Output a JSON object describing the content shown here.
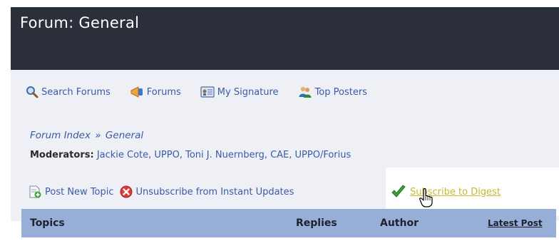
{
  "header": {
    "title": "Forum: General"
  },
  "toolbar": {
    "items": [
      {
        "label": "Search Forums",
        "icon": "magnifier-icon"
      },
      {
        "label": "Forums",
        "icon": "megaphone-icon"
      },
      {
        "label": "My Signature",
        "icon": "signature-card-icon"
      },
      {
        "label": "Top Posters",
        "icon": "users-icon"
      }
    ]
  },
  "breadcrumb": {
    "index": "Forum Index",
    "separator": "»",
    "current": "General"
  },
  "moderators": {
    "label": "Moderators:",
    "names": "Jackie Cote, UPPO, Toni J. Nuernberg, CAE, UPPO/Forius"
  },
  "actions": {
    "post": "Post New Topic",
    "unsubscribe": "Unsubscribe from Instant Updates",
    "digest": "Subscribe to Digest"
  },
  "table": {
    "columns": [
      "Topics",
      "Replies",
      "Author",
      "Latest Post"
    ]
  },
  "colors": {
    "header_bg": "#2a2f3a",
    "page_bg": "#eef0f6",
    "link": "#3a5aa8",
    "table_header_bg": "#97aed6",
    "digest_link": "#c8b830"
  }
}
